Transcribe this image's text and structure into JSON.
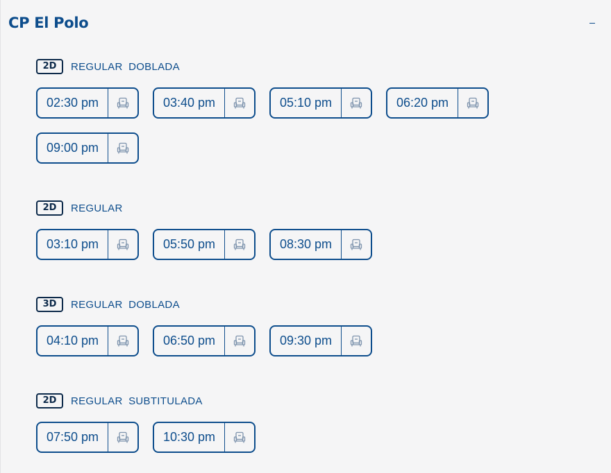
{
  "cinema": {
    "name": "CP El Polo",
    "collapse_symbol": "−"
  },
  "formats": [
    {
      "badge": "2D",
      "label": "REGULAR  DOBLADA",
      "times": [
        "02:30 pm",
        "03:40 pm",
        "05:10 pm",
        "06:20 pm",
        "09:00 pm"
      ]
    },
    {
      "badge": "2D",
      "label": "REGULAR",
      "times": [
        "03:10 pm",
        "05:50 pm",
        "08:30 pm"
      ]
    },
    {
      "badge": "3D",
      "label": "REGULAR  DOBLADA",
      "times": [
        "04:10 pm",
        "06:50 pm",
        "09:30 pm"
      ]
    },
    {
      "badge": "2D",
      "label": "REGULAR  SUBTITULADA",
      "times": [
        "07:50 pm",
        "10:30 pm"
      ]
    }
  ],
  "icons": {
    "seat": "seat-icon",
    "collapse": "minus-icon"
  },
  "colors": {
    "primary": "#0d4d8c",
    "badge_border": "#0d2a4a",
    "seat_icon": "#7d93ad",
    "background": "#f5f5f6"
  }
}
